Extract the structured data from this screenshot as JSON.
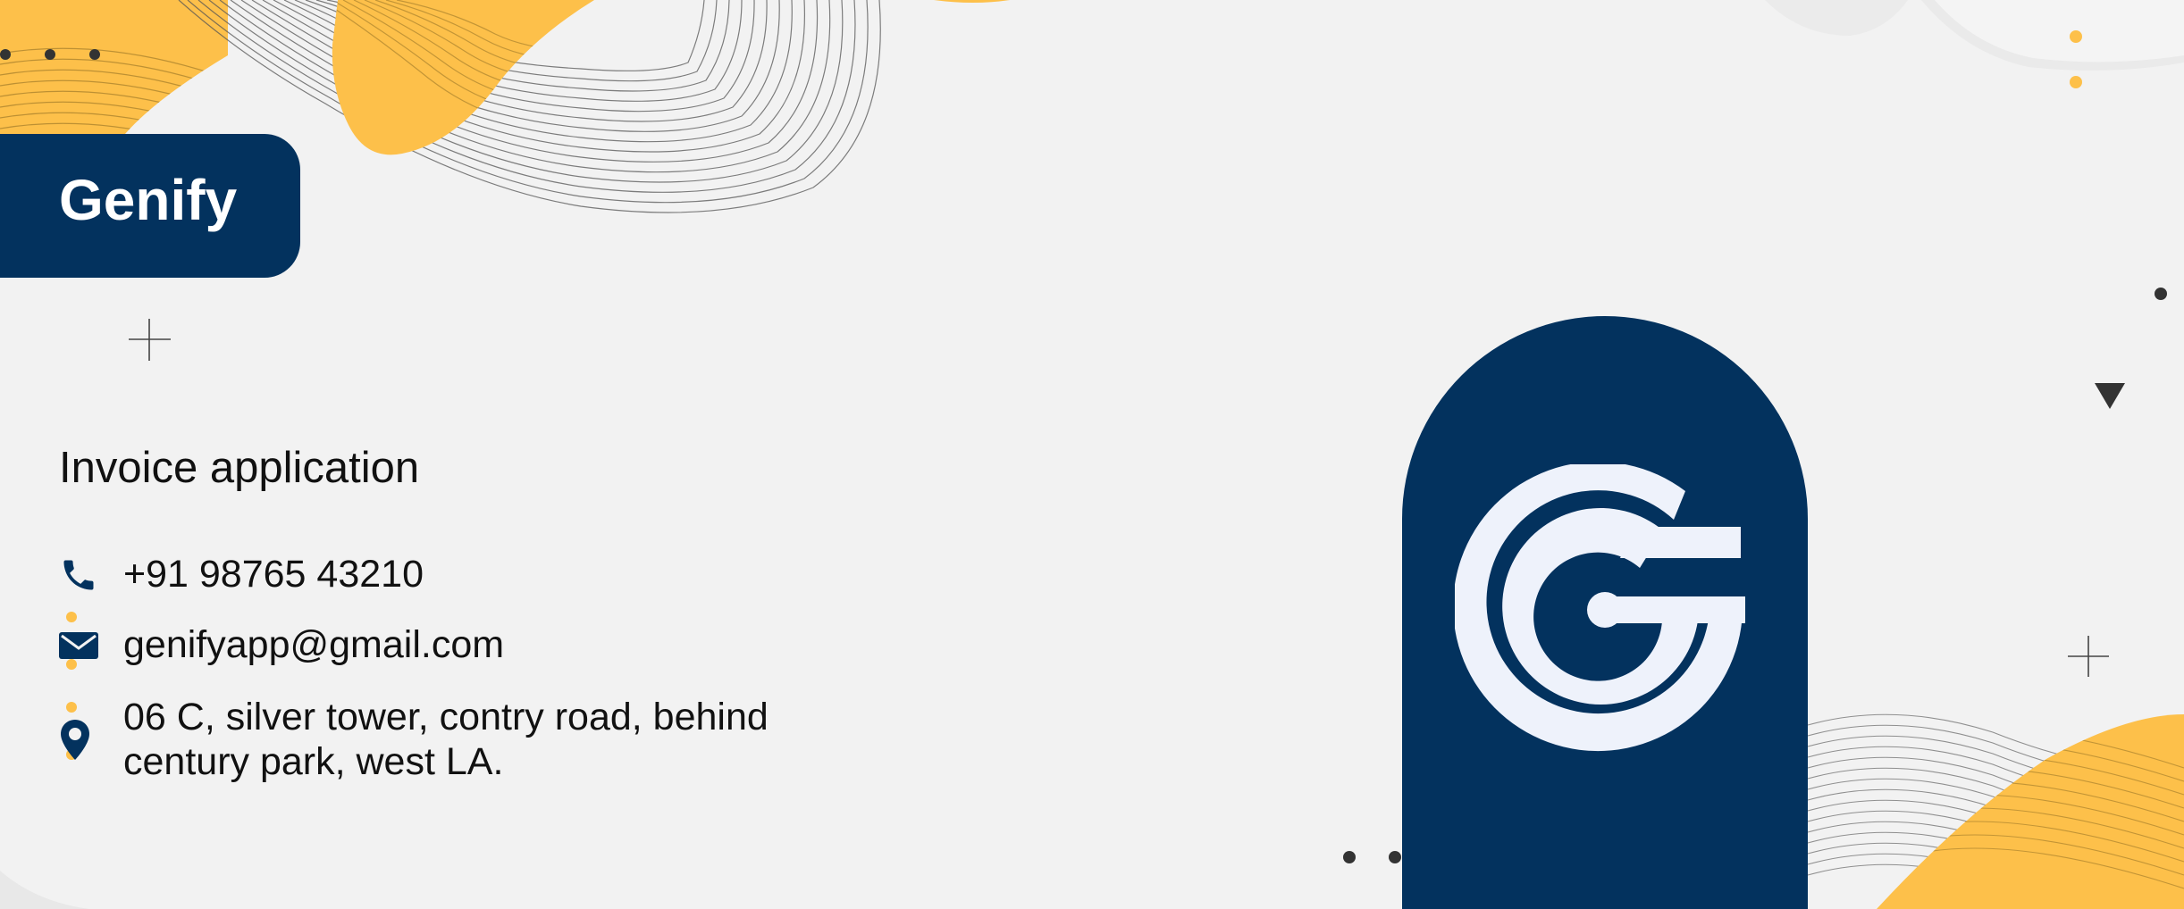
{
  "brand": {
    "name": "Genify"
  },
  "subtitle": "Invoice application",
  "contact": {
    "phone": "+91 98765 43210",
    "email": "genifyapp@gmail.com",
    "address_line1": "06 C, silver tower, contry road, behind",
    "address_line2": "century park, west LA."
  },
  "icons": {
    "phone": "phone-icon",
    "email": "envelope-icon",
    "address": "map-pin-icon",
    "logo": "genify-g-logo"
  },
  "colors": {
    "navy": "#03325e",
    "accent_yellow": "#fdc04a",
    "background": "#f2f2f2",
    "text": "#111111",
    "logo_fill": "#eef2fb"
  }
}
